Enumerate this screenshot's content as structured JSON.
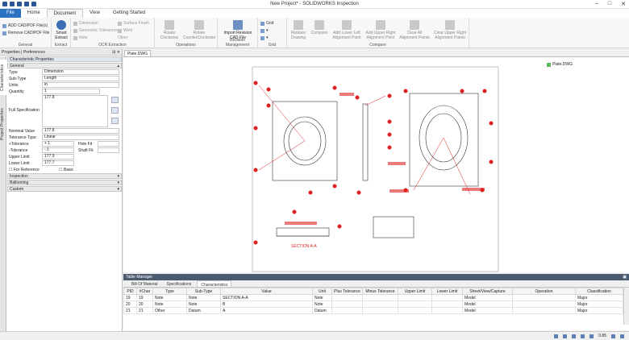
{
  "window": {
    "title": "New Project* - SOLIDWORKS Inspection"
  },
  "tabs": [
    "File",
    "Home",
    "Document",
    "View",
    "Getting Started"
  ],
  "ribbon": {
    "extract": {
      "add": "ADD CAD/PDF File(s)",
      "remove": "Remove CAD/PDF File",
      "label": "General"
    },
    "smart": {
      "label": "Smart Extract",
      "group": "Extract"
    },
    "ocr": {
      "items": [
        "Dimension",
        "Geometric Tolerances",
        "Note",
        "Surface Finish",
        "Weld",
        "Other"
      ],
      "label": "OCR Extraction"
    },
    "operations": {
      "rotate_cw": "Rotate Clockwise",
      "rotate_ccw": "Rotate CounterClockwise",
      "label": "Operations"
    },
    "revision": {
      "import": "Import Revision CAD File",
      "label": "Revision Management"
    },
    "grid": {
      "label": "Grid",
      "item": "Grid"
    },
    "compare": {
      "buttons": [
        "Replace Drawing",
        "Compare",
        "Add Lower Left Alignment Point",
        "Add Upper Right Alignment Point",
        "Clear All Alignment Points",
        "Clear Upper Right Alignment Points"
      ],
      "label": "Compare"
    }
  },
  "left_panel": {
    "header": "Properties | Preferences",
    "vtabs": [
      "Characteristics",
      "Project Properties"
    ],
    "title": "Characteristic Properties",
    "sections": {
      "general": "General",
      "inspection": "Inspection",
      "ballooning": "Ballooning",
      "custom": "Custom"
    },
    "fields": {
      "type": "Dimension",
      "subtype": "Length",
      "units": "in",
      "quantity": "1",
      "full_spec": "177.8",
      "nominal": "177.8",
      "tol_type": "Linear",
      "plus_tol": "+.1",
      "minus_tol": "-.1",
      "hole_fit": "",
      "shaft_fit": "",
      "upper": "177.9",
      "lower": "177.7"
    },
    "labels": {
      "type": "Type",
      "subtype": "Sub-Type",
      "units": "Units",
      "quantity": "Quantity",
      "full_spec": "Full Specification",
      "nominal": "Nominal Value",
      "tol_type": "Tolerance Type",
      "plus_tol": "+Tolerance",
      "minus_tol": "-Tolerance",
      "hole_fit": "Hole Fit",
      "shaft_fit": "Shaft Fit",
      "upper": "Upper Limit",
      "lower": "Lower Limit",
      "for_ref": "For Reference",
      "basic": "Basic"
    }
  },
  "drawing": {
    "tab": "Plate.DWG",
    "file_label": "Plate.DWG",
    "section": "SECTION A-A"
  },
  "table_manager": {
    "title": "Table Manager",
    "tabs": [
      "Bill Of Material",
      "Specifications",
      "Characteristics"
    ],
    "columns": [
      "PID",
      "#Char",
      "Type",
      "Sub-Type",
      "Value",
      "Unit",
      "Plus Tolerance",
      "Minus Tolerance",
      "Upper Limit",
      "Lower Limit",
      "Sheet/View/Capture",
      "Operation",
      "Classification"
    ],
    "rows": [
      [
        "19",
        "19",
        "Note",
        "Note",
        "SECTION A-A",
        "Note",
        "",
        "",
        "",
        "",
        "Model",
        "",
        "Major"
      ],
      [
        "20",
        "20",
        "Note",
        "Note",
        "B",
        "Note",
        "",
        "",
        "",
        "",
        "Model",
        "",
        "Major"
      ],
      [
        "21",
        "21",
        "Other",
        "Datum",
        "A",
        "Datum",
        "",
        "",
        "",
        "",
        "Model",
        "",
        "Major"
      ]
    ]
  },
  "status": {
    "zoom": "0.85"
  }
}
